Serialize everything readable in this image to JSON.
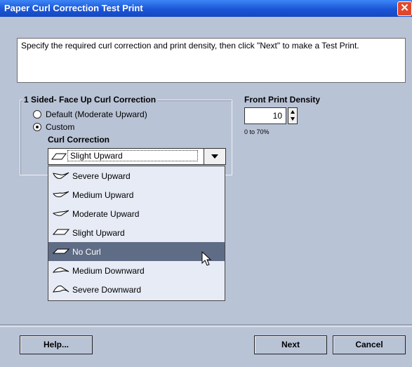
{
  "window": {
    "title": "Paper Curl Correction Test Print"
  },
  "instructions": "Specify the required curl correction and print density, then click \"Next\" to make a Test Print.",
  "curl_group": {
    "title": "1 Sided- Face Up Curl Correction",
    "radio_default": "Default (Moderate Upward)",
    "radio_custom": "Custom",
    "selected": "custom",
    "curl_label": "Curl Correction",
    "combo_value": "Slight Upward",
    "options": [
      "Severe Upward",
      "Medium Upward",
      "Moderate Upward",
      "Slight Upward",
      "No Curl",
      "Medium Downward",
      "Severe Downward"
    ],
    "highlighted": "No Curl"
  },
  "density": {
    "label": "Front Print Density",
    "value": "10",
    "range": "0 to 70%"
  },
  "buttons": {
    "help": "Help...",
    "next": "Next",
    "cancel": "Cancel"
  },
  "colors": {
    "background": "#b9c3d6",
    "title_bar": "#1a55d6",
    "highlight": "#5f6c85"
  }
}
